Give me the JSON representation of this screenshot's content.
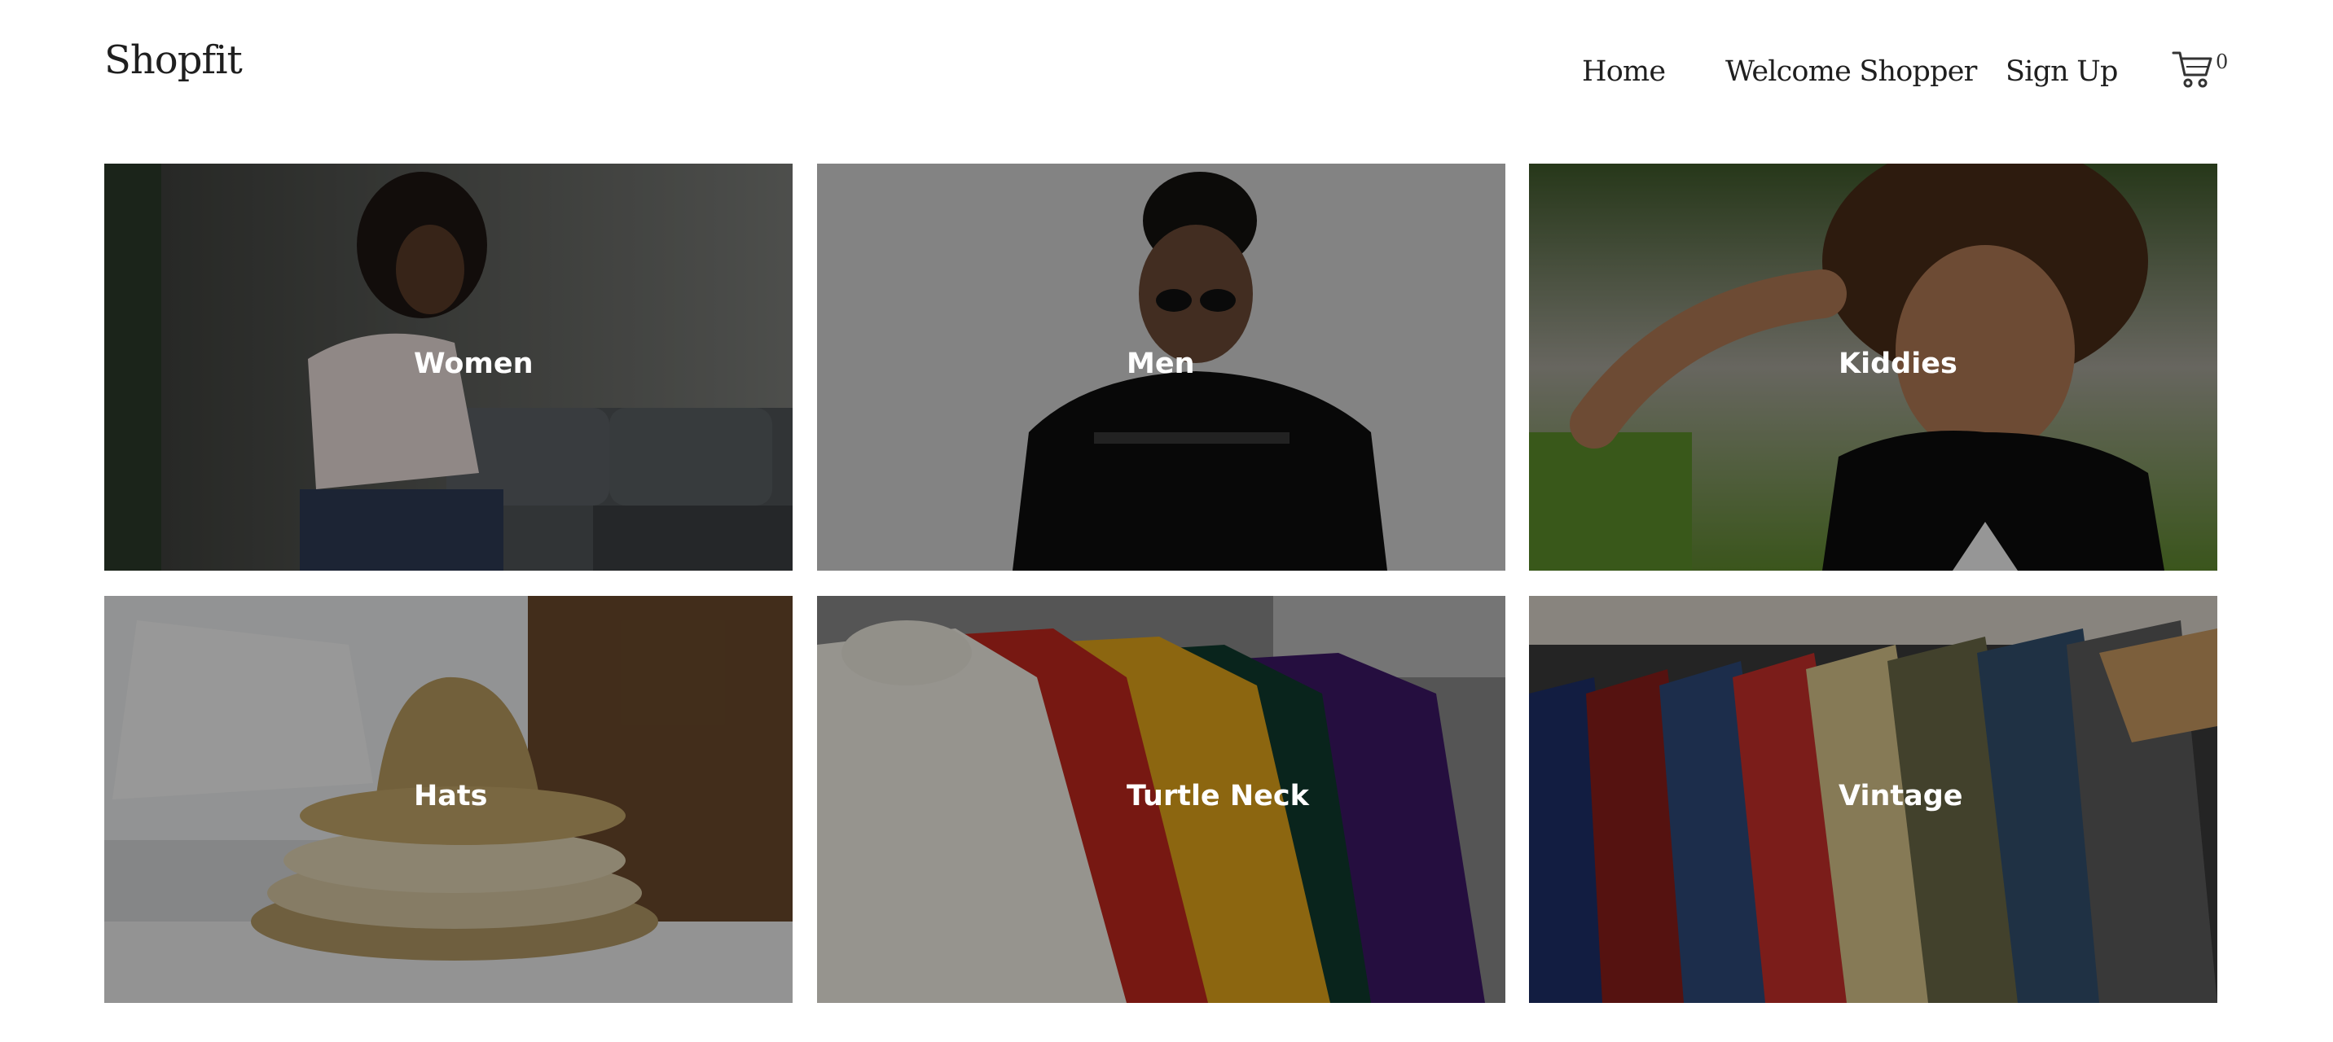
{
  "brand": {
    "logo_text": "Shopfit"
  },
  "nav": {
    "home": "Home",
    "welcome": "Welcome Shopper",
    "signup": "Sign Up"
  },
  "cart": {
    "icon": "cart-icon",
    "count": "0"
  },
  "categories": [
    {
      "label": "Women",
      "image": "woman-sitting-on-sofa-photo"
    },
    {
      "label": "Men",
      "image": "man-with-sunglasses-photo"
    },
    {
      "label": "Kiddies",
      "image": "smiling-child-photo"
    },
    {
      "label": "Hats",
      "image": "stacked-straw-hats-photo"
    },
    {
      "label": "Turtle Neck",
      "image": "turtleneck-sweaters-on-rack-photo"
    },
    {
      "label": "Vintage",
      "image": "vintage-clothing-rack-photo"
    }
  ],
  "colors": {
    "background": "#ffffff",
    "text": "#1f1f1f",
    "overlay": "rgba(0,0,0,0.38)",
    "label": "#ffffff"
  }
}
